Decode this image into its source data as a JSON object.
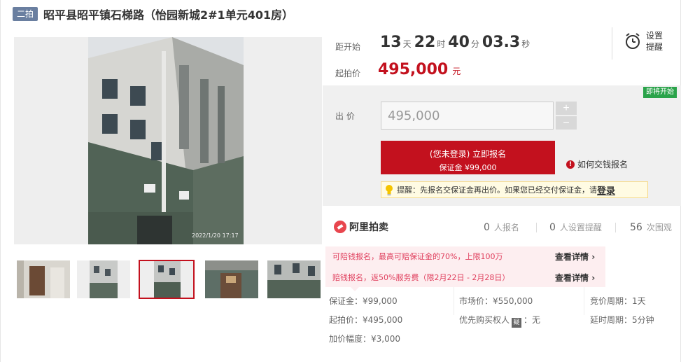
{
  "title": {
    "round_badge": "二拍",
    "text": "昭平县昭平镇石梯路（怡园新城2#1单元401房）"
  },
  "gallery": {
    "photo_timestamp": "2022/1/20  17:17",
    "thumbnail_count": 5,
    "active_thumbnail": 3
  },
  "countdown": {
    "label": "距开始",
    "days": "13",
    "days_unit": "天",
    "hours": "22",
    "hours_unit": "时",
    "minutes": "40",
    "minutes_unit": "分",
    "seconds": "03.3",
    "seconds_unit": "秒"
  },
  "start_price": {
    "label": "起拍价",
    "value": "495,000",
    "unit": "元"
  },
  "reminder": {
    "label": "设置提醒"
  },
  "bid": {
    "status_badge": "即将开始",
    "label": "出  价",
    "input_value": "495,000",
    "plus": "+",
    "minus": "−",
    "register_line1": "(您未登录) 立即报名",
    "register_line2": "保证金 ¥99,000",
    "howto_label": "如何交钱报名",
    "tip_text": "提醒：先报名交保证金再出价。如果您已经交付保证金，请",
    "tip_link": "登录"
  },
  "stats": {
    "brand": "阿里拍卖",
    "signups_count": "0",
    "signups_label": "人报名",
    "reminders_count": "0",
    "reminders_label": "人设置提醒",
    "views_count": "56",
    "views_label": "次围观"
  },
  "promo": {
    "line1": "可陪钱报名，最高可赔保证金的70%，上限100万",
    "line1_link": "查看详情",
    "line2": "赔钱报名，返50%服务费（限2月22日 - 2月28日）",
    "line2_link": "查看详情"
  },
  "details": {
    "deposit": "保证金：¥99,000",
    "start_price": "起拍价：¥495,000",
    "increment": "加价幅度：¥3,000",
    "market_price": "市场价：¥550,000",
    "priority_prefix": "优先购买权人",
    "priority_icon": "疑",
    "priority_value": "：无",
    "bid_cycle": "竞价周期：1天",
    "delay_cycle": "延时周期：5分钟"
  },
  "colors": {
    "accent_red": "#c3111e",
    "badge_green": "#2aa34a",
    "badge_blue": "#6a7fa0",
    "promo_pink": "#e0405e"
  }
}
